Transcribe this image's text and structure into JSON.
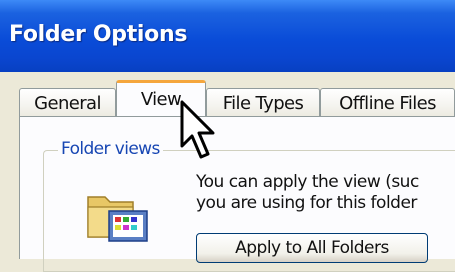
{
  "window": {
    "title": "Folder Options"
  },
  "tabs": [
    {
      "label": "General",
      "active": false
    },
    {
      "label": "View",
      "active": true
    },
    {
      "label": "File Types",
      "active": false
    },
    {
      "label": "Offline Files",
      "active": false
    }
  ],
  "folder_views": {
    "group_title": "Folder views",
    "description_line1": "You can apply the view (suc",
    "description_line2": "you are using for this folder",
    "apply_button_label": "Apply to All Folders",
    "icon": "folder-views-icon"
  },
  "cursor": {
    "icon": "mouse-pointer-icon"
  },
  "colors": {
    "titlebar": "#0a4cd8",
    "active_tab_highlight": "#f5a63c",
    "group_title_text": "#1746b3",
    "window_face": "#ece9d8"
  }
}
